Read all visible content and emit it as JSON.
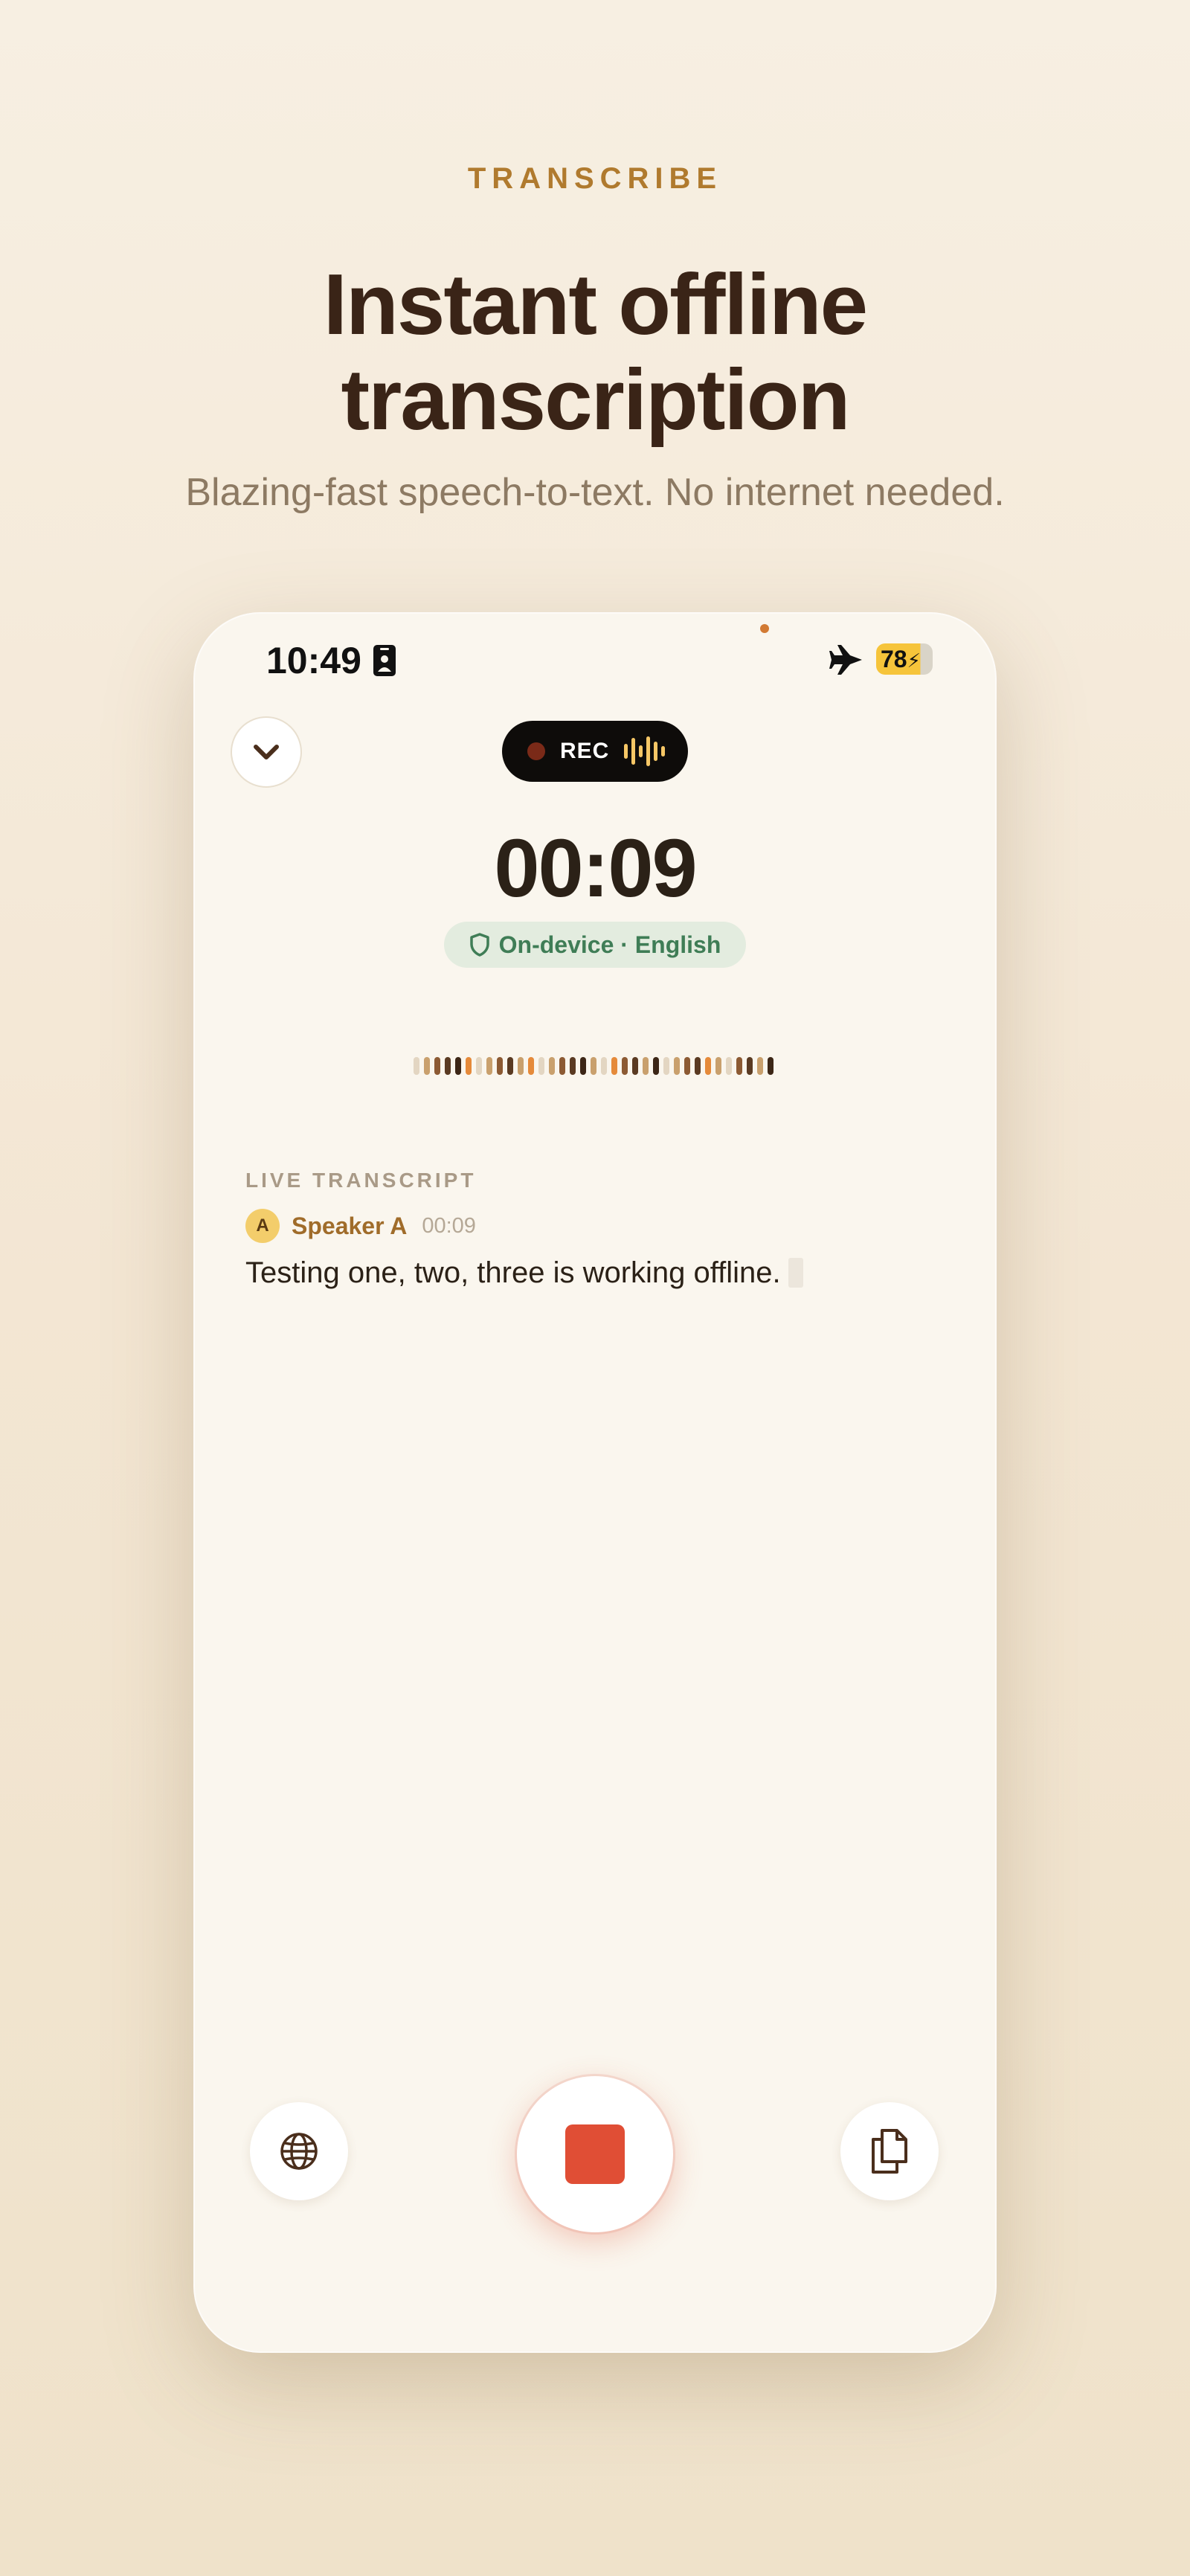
{
  "hero": {
    "eyebrow": "TRANSCRIBE",
    "headline_line1": "Instant offline",
    "headline_line2": "transcription",
    "subhead": "Blazing-fast speech-to-text. No internet needed."
  },
  "status_bar": {
    "time": "10:49",
    "battery": "78"
  },
  "recorder": {
    "rec_label": "REC",
    "elapsed": "00:09",
    "privacy_badge": "On-device · English"
  },
  "waveform": {
    "bar_colors": [
      "#e3d6c2",
      "#c9a06d",
      "#8c5a33",
      "#5a3a22",
      "#3c2616",
      "#e58a3a",
      "#e3d6c2",
      "#c9a06d",
      "#8c5a33",
      "#5a3a22",
      "#c9a06d",
      "#e58a3a",
      "#e3d6c2",
      "#c9a06d",
      "#8c5a33",
      "#5a3a22",
      "#3c2616",
      "#c9a06d",
      "#e3d6c2",
      "#e58a3a",
      "#8c5a33",
      "#5a3a22",
      "#c9a06d",
      "#3c2616",
      "#e3d6c2",
      "#c9a06d",
      "#8c5a33",
      "#5a3a22",
      "#e58a3a",
      "#c9a06d",
      "#e3d6c2",
      "#8c5a33",
      "#5a3a22",
      "#c9a06d",
      "#3c2616"
    ]
  },
  "transcript": {
    "section_label": "LIVE TRANSCRIPT",
    "speaker_initial": "A",
    "speaker_name": "Speaker A",
    "timestamp": "00:09",
    "text": "Testing one, two, three is working offline."
  },
  "colors": {
    "accent": "#b07a2e",
    "stop": "#e04e35",
    "on_device": "#3f7d56"
  }
}
